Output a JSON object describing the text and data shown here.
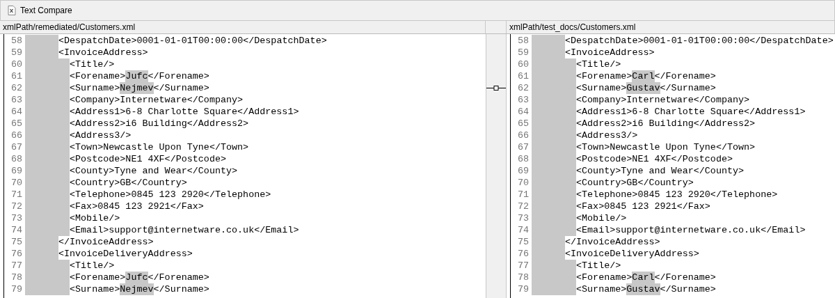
{
  "window": {
    "title": "Text Compare"
  },
  "panes": [
    {
      "path": "xmlPath/remediated/Customers.xml",
      "lines": [
        {
          "number": "58",
          "kind": "outer",
          "linked": false,
          "segments": [
            {
              "text": "<DespatchDate>0001-01-01T00:00:00</DespatchDate>",
              "highlighted": false
            }
          ]
        },
        {
          "number": "59",
          "kind": "outer",
          "linked": false,
          "segments": [
            {
              "text": "<InvoiceAddress>",
              "highlighted": false
            }
          ]
        },
        {
          "number": "60",
          "kind": "inner",
          "linked": false,
          "segments": [
            {
              "text": "<Title/>",
              "highlighted": false
            }
          ]
        },
        {
          "number": "61",
          "kind": "inner",
          "linked": false,
          "segments": [
            {
              "text": "<Forename>",
              "highlighted": false
            },
            {
              "text": "Jufc",
              "highlighted": true
            },
            {
              "text": "</Forename>",
              "highlighted": false
            }
          ]
        },
        {
          "number": "62",
          "kind": "inner",
          "linked": true,
          "segments": [
            {
              "text": "<Surname>",
              "highlighted": false
            },
            {
              "text": "Nejmev",
              "highlighted": true
            },
            {
              "text": "</Surname>",
              "highlighted": false
            }
          ]
        },
        {
          "number": "63",
          "kind": "inner",
          "linked": false,
          "segments": [
            {
              "text": "<Company>Internetware</Company>",
              "highlighted": false
            }
          ]
        },
        {
          "number": "64",
          "kind": "inner",
          "linked": false,
          "segments": [
            {
              "text": "<Address1>6-8 Charlotte Square</Address1>",
              "highlighted": false
            }
          ]
        },
        {
          "number": "65",
          "kind": "inner",
          "linked": false,
          "segments": [
            {
              "text": "<Address2>i6 Building</Address2>",
              "highlighted": false
            }
          ]
        },
        {
          "number": "66",
          "kind": "inner",
          "linked": false,
          "segments": [
            {
              "text": "<Address3/>",
              "highlighted": false
            }
          ]
        },
        {
          "number": "67",
          "kind": "inner",
          "linked": false,
          "segments": [
            {
              "text": "<Town>Newcastle Upon Tyne</Town>",
              "highlighted": false
            }
          ]
        },
        {
          "number": "68",
          "kind": "inner",
          "linked": false,
          "segments": [
            {
              "text": "<Postcode>NE1 4XF</Postcode>",
              "highlighted": false
            }
          ]
        },
        {
          "number": "69",
          "kind": "inner",
          "linked": false,
          "segments": [
            {
              "text": "<County>Tyne and Wear</County>",
              "highlighted": false
            }
          ]
        },
        {
          "number": "70",
          "kind": "inner",
          "linked": false,
          "segments": [
            {
              "text": "<Country>GB</Country>",
              "highlighted": false
            }
          ]
        },
        {
          "number": "71",
          "kind": "inner",
          "linked": false,
          "segments": [
            {
              "text": "<Telephone>0845 123 2920</Telephone>",
              "highlighted": false
            }
          ]
        },
        {
          "number": "72",
          "kind": "inner",
          "linked": false,
          "segments": [
            {
              "text": "<Fax>0845 123 2921</Fax>",
              "highlighted": false
            }
          ]
        },
        {
          "number": "73",
          "kind": "inner",
          "linked": false,
          "segments": [
            {
              "text": "<Mobile/>",
              "highlighted": false
            }
          ]
        },
        {
          "number": "74",
          "kind": "inner",
          "linked": false,
          "segments": [
            {
              "text": "<Email>support@internetware.co.uk</Email>",
              "highlighted": false
            }
          ]
        },
        {
          "number": "75",
          "kind": "outer",
          "linked": false,
          "segments": [
            {
              "text": "</InvoiceAddress>",
              "highlighted": false
            }
          ]
        },
        {
          "number": "76",
          "kind": "outer",
          "linked": false,
          "segments": [
            {
              "text": "<InvoiceDeliveryAddress>",
              "highlighted": false
            }
          ]
        },
        {
          "number": "77",
          "kind": "inner",
          "linked": false,
          "segments": [
            {
              "text": "<Title/>",
              "highlighted": false
            }
          ]
        },
        {
          "number": "78",
          "kind": "inner",
          "linked": false,
          "segments": [
            {
              "text": "<Forename>",
              "highlighted": false
            },
            {
              "text": "Jufc",
              "highlighted": true
            },
            {
              "text": "</Forename>",
              "highlighted": false
            }
          ]
        },
        {
          "number": "79",
          "kind": "inner",
          "linked": false,
          "segments": [
            {
              "text": "<Surname>",
              "highlighted": false
            },
            {
              "text": "Nejmev",
              "highlighted": true
            },
            {
              "text": "</Surname>",
              "highlighted": false
            }
          ]
        }
      ]
    },
    {
      "path": "xmlPath/test_docs/Customers.xml",
      "lines": [
        {
          "number": "58",
          "kind": "outer",
          "segments": [
            {
              "text": "<DespatchDate>0001-01-01T00:00:00</DespatchDate>",
              "highlighted": false
            }
          ]
        },
        {
          "number": "59",
          "kind": "outer",
          "segments": [
            {
              "text": "<InvoiceAddress>",
              "highlighted": false
            }
          ]
        },
        {
          "number": "60",
          "kind": "inner",
          "segments": [
            {
              "text": "<Title/>",
              "highlighted": false
            }
          ]
        },
        {
          "number": "61",
          "kind": "inner",
          "segments": [
            {
              "text": "<Forename>",
              "highlighted": false
            },
            {
              "text": "Carl",
              "highlighted": true
            },
            {
              "text": "</Forename>",
              "highlighted": false
            }
          ]
        },
        {
          "number": "62",
          "kind": "inner",
          "segments": [
            {
              "text": "<Surname>",
              "highlighted": false
            },
            {
              "text": "Gustav",
              "highlighted": true
            },
            {
              "text": "</Surname>",
              "highlighted": false
            }
          ]
        },
        {
          "number": "63",
          "kind": "inner",
          "segments": [
            {
              "text": "<Company>Internetware</Company>",
              "highlighted": false
            }
          ]
        },
        {
          "number": "64",
          "kind": "inner",
          "segments": [
            {
              "text": "<Address1>6-8 Charlotte Square</Address1>",
              "highlighted": false
            }
          ]
        },
        {
          "number": "65",
          "kind": "inner",
          "segments": [
            {
              "text": "<Address2>i6 Building</Address2>",
              "highlighted": false
            }
          ]
        },
        {
          "number": "66",
          "kind": "inner",
          "segments": [
            {
              "text": "<Address3/>",
              "highlighted": false
            }
          ]
        },
        {
          "number": "67",
          "kind": "inner",
          "segments": [
            {
              "text": "<Town>Newcastle Upon Tyne</Town>",
              "highlighted": false
            }
          ]
        },
        {
          "number": "68",
          "kind": "inner",
          "segments": [
            {
              "text": "<Postcode>NE1 4XF</Postcode>",
              "highlighted": false
            }
          ]
        },
        {
          "number": "69",
          "kind": "inner",
          "segments": [
            {
              "text": "<County>Tyne and Wear</County>",
              "highlighted": false
            }
          ]
        },
        {
          "number": "70",
          "kind": "inner",
          "segments": [
            {
              "text": "<Country>GB</Country>",
              "highlighted": false
            }
          ]
        },
        {
          "number": "71",
          "kind": "inner",
          "segments": [
            {
              "text": "<Telephone>0845 123 2920</Telephone>",
              "highlighted": false
            }
          ]
        },
        {
          "number": "72",
          "kind": "inner",
          "segments": [
            {
              "text": "<Fax>0845 123 2921</Fax>",
              "highlighted": false
            }
          ]
        },
        {
          "number": "73",
          "kind": "inner",
          "segments": [
            {
              "text": "<Mobile/>",
              "highlighted": false
            }
          ]
        },
        {
          "number": "74",
          "kind": "inner",
          "segments": [
            {
              "text": "<Email>support@internetware.co.uk</Email>",
              "highlighted": false
            }
          ]
        },
        {
          "number": "75",
          "kind": "outer",
          "segments": [
            {
              "text": "</InvoiceAddress>",
              "highlighted": false
            }
          ]
        },
        {
          "number": "76",
          "kind": "outer",
          "segments": [
            {
              "text": "<InvoiceDeliveryAddress>",
              "highlighted": false
            }
          ]
        },
        {
          "number": "77",
          "kind": "inner",
          "segments": [
            {
              "text": "<Title/>",
              "highlighted": false
            }
          ]
        },
        {
          "number": "78",
          "kind": "inner",
          "segments": [
            {
              "text": "<Forename>",
              "highlighted": false
            },
            {
              "text": "Carl",
              "highlighted": true
            },
            {
              "text": "</Forename>",
              "highlighted": false
            }
          ]
        },
        {
          "number": "79",
          "kind": "inner",
          "segments": [
            {
              "text": "<Surname>",
              "highlighted": false
            },
            {
              "text": "Gustav",
              "highlighted": true
            },
            {
              "text": "</Surname>",
              "highlighted": false
            }
          ]
        }
      ]
    }
  ]
}
